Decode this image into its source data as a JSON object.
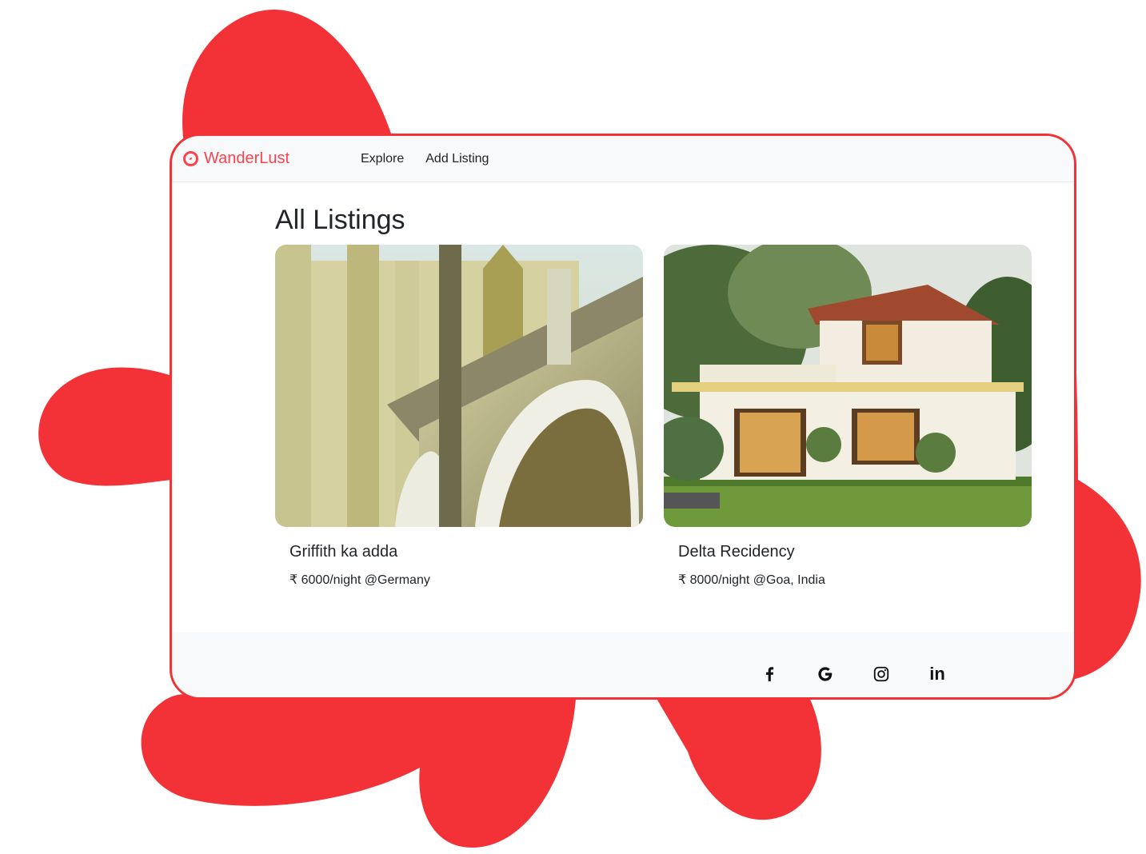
{
  "navbar": {
    "brand": "WanderLust",
    "brand_icon": "compass-icon",
    "links": [
      "Explore",
      "Add Listing"
    ]
  },
  "main": {
    "title": "All Listings",
    "listings": [
      {
        "title": "Griffith ka adda",
        "price_line": "₹ 6000/night @Germany"
      },
      {
        "title": "Delta Recidency",
        "price_line": "₹ 8000/night @Goa, India"
      }
    ]
  },
  "footer": {
    "social_icons": [
      "facebook-icon",
      "google-icon",
      "instagram-icon",
      "linkedin-icon"
    ],
    "linkedin_glyph": "in"
  },
  "colors": {
    "accent": "#fe424d",
    "blob": "#f23236",
    "navbar_bg": "#f8f9fa"
  }
}
